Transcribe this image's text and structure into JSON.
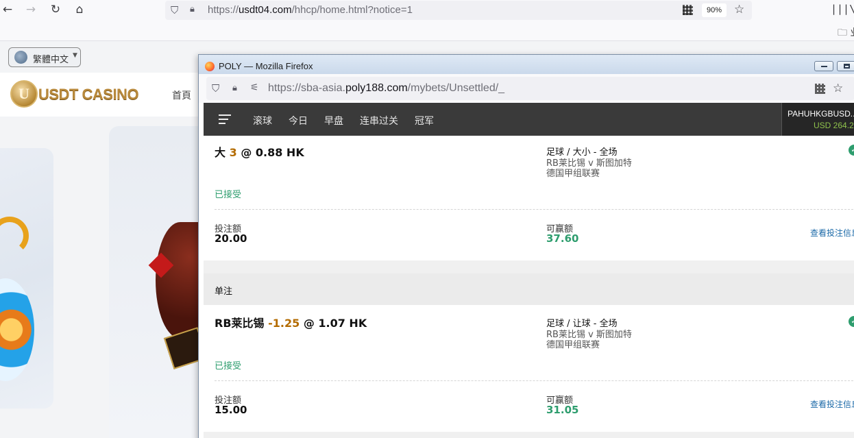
{
  "back_browser": {
    "url_prefix": "https://",
    "url_host": "usdt04.com",
    "url_path": "/hhcp/home.html?notice=1",
    "zoom": "90%",
    "bookmark_folder": "业"
  },
  "casino": {
    "language": "繁體中文",
    "logo_text": "USDT CASINO",
    "logo_letter": "U",
    "nav_home": "首頁"
  },
  "window": {
    "title": "POLY — Mozilla Firefox",
    "url_prefix": "https://sba-asia.",
    "url_host": "poly188.com",
    "url_path": "/mybets/Unsettled/_"
  },
  "nav": {
    "tabs": [
      "滚球",
      "今日",
      "早盘",
      "连串过关",
      "冠军"
    ],
    "account_name": "PAHUHKGBUSD...",
    "balance": "USD 264.2"
  },
  "bets": [
    {
      "selection": "大",
      "handicap": "3",
      "odds": "@ 0.88 HK",
      "market": "足球 / 大小 - 全场",
      "match": "RB莱比锡 v 斯图加特",
      "league": "德国甲组联赛",
      "status": "已接受",
      "stake_label": "投注额",
      "stake": "20.00",
      "win_label": "可赢额",
      "win": "37.60",
      "detail_link": "查看投注信息"
    },
    {
      "selection": "RB莱比锡",
      "handicap": "-1.25",
      "odds": "@ 1.07 HK",
      "market": "足球 / 让球 - 全场",
      "match": "RB莱比锡 v 斯图加特",
      "league": "德国甲组联赛",
      "status": "已接受",
      "stake_label": "投注额",
      "stake": "15.00",
      "win_label": "可赢额",
      "win": "31.05",
      "detail_link": "查看投注信息"
    }
  ],
  "section_label": "单注",
  "colors": {
    "nav_bg": "#3a3a3a",
    "accepted": "#2e9d6e",
    "handicap": "#b36b00",
    "link": "#1c6aa8",
    "balance": "#8fc24c"
  }
}
